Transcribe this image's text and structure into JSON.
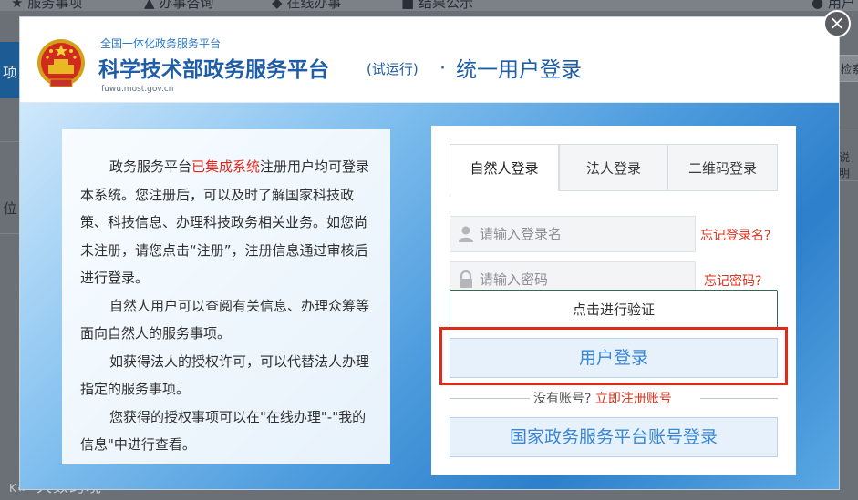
{
  "background": {
    "nav_items": [
      "服务事项",
      "办事咨询",
      "在线办事",
      "结果公示",
      "用户"
    ],
    "left_labels": [
      "项",
      "位"
    ],
    "right_labels": [
      "检索",
      "说明"
    ]
  },
  "watermark": "大数跨境",
  "modal": {
    "brand_small": "全国一体化政务服务平台",
    "brand_title": "科学技术部政务服务平台",
    "brand_trial": "(试运行)",
    "brand_sep": "·",
    "brand_login": "统一用户登录",
    "brand_url": "fuwu.most.gov.cn",
    "close_label": "×"
  },
  "info": {
    "p1_before": "政务服务平台",
    "p1_highlight": "已集成系统",
    "p1_after": "注册用户均可登录本系统。您注册后，可以及时了解国家科技政策、科技信息、办理科技政务相关业务。如您尚未注册，请您点击“注册”，注册信息通过审核后进行登录。",
    "p2": "自然人用户可以查阅有关信息、办理众筹等面向自然人的服务事项。",
    "p3": "如获得法人的授权许可，可以代替法人办理指定的服务事项。",
    "p4": "您获得的授权事项可以在\"在线办理\"-\"我的信息\"中进行查看。"
  },
  "login": {
    "tabs": [
      {
        "label": "自然人登录",
        "active": true
      },
      {
        "label": "法人登录",
        "active": false
      },
      {
        "label": "二维码登录",
        "active": false
      }
    ],
    "username_placeholder": "请输入登录名",
    "password_placeholder": "请输入密码",
    "forgot_username": "忘记登录名?",
    "forgot_password": "忘记密码?",
    "verify_label": "点击进行验证",
    "login_label": "用户登录",
    "no_account": "没有账号?",
    "register_label": "立即注册账号",
    "national_label": "国家政务服务平台账号登录"
  },
  "colors": {
    "brand_blue": "#1f5da6",
    "link_red": "#d8341f",
    "highlight_red": "#e02a1a",
    "button_blue_text": "#3a87d6"
  }
}
